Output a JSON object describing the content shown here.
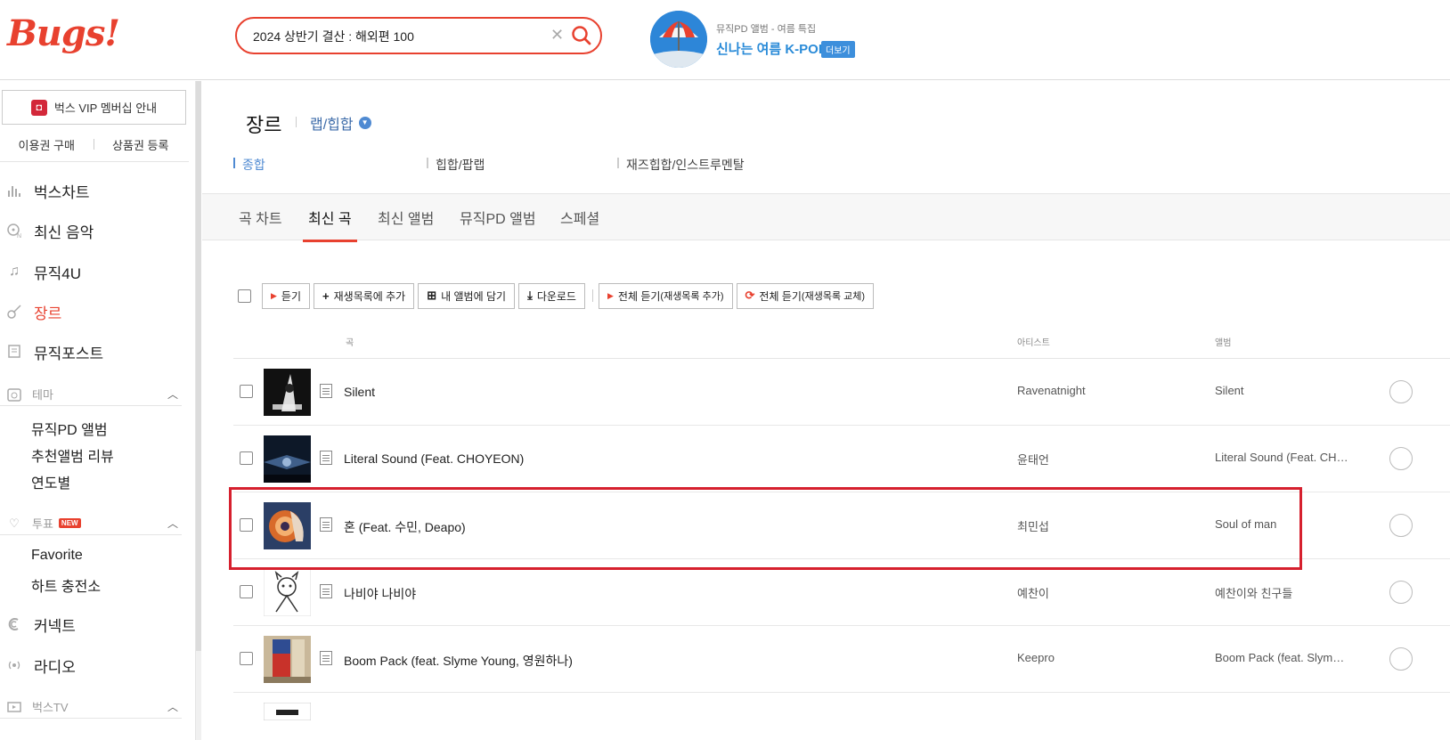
{
  "brand": {
    "logo_text": "Bugs!",
    "accent_color": "#e8412f"
  },
  "search": {
    "value": "2024 상반기 결산 : 해외편 100",
    "clear_icon": "close-icon",
    "search_icon": "search-icon"
  },
  "promo": {
    "subtitle": "뮤직PD 앨범 - 여름 특집",
    "title": "신나는 여름 K-POP",
    "more_label": "더보기"
  },
  "sidebar": {
    "vip_label": "벅스 VIP 멤버십 안내",
    "links": [
      "이용권 구매",
      "상품권 등록"
    ],
    "items": [
      {
        "label": "벅스차트",
        "icon": "chart-icon"
      },
      {
        "label": "최신 음악",
        "icon": "new-music-icon"
      },
      {
        "label": "뮤직4U",
        "icon": "music-note-icon"
      },
      {
        "label": "장르",
        "icon": "guitar-icon",
        "active": true
      },
      {
        "label": "뮤직포스트",
        "icon": "post-icon"
      }
    ],
    "theme": {
      "label": "테마",
      "items": [
        "뮤직PD 앨범",
        "추천앨범 리뷰",
        "연도별"
      ]
    },
    "vote": {
      "label": "투표",
      "badge": "NEW",
      "items": [
        "Favorite",
        "하트 충전소"
      ]
    },
    "bottom_items": [
      {
        "label": "커넥트",
        "icon": "connect-icon"
      },
      {
        "label": "라디오",
        "icon": "radio-icon"
      }
    ],
    "tv": {
      "label": "벅스TV"
    }
  },
  "main": {
    "title": "장르",
    "genre": "랩/힙합",
    "subgenres": [
      "종합",
      "힙합/팝랩",
      "재즈힙합/인스트루멘탈"
    ],
    "tabs": [
      "곡 차트",
      "최신 곡",
      "최신 앨범",
      "뮤직PD 앨범",
      "스페셜"
    ],
    "active_tab": "최신 곡",
    "toolbar": {
      "listen": "듣기",
      "add_playlist": "재생목록에 추가",
      "add_album": "내 앨범에 담기",
      "download": "다운로드",
      "play_all_add": "전체 듣기",
      "play_all_add_sub": "(재생목록 추가)",
      "play_all_replace": "전체 듣기",
      "play_all_replace_sub": "(재생목록 교체)"
    },
    "columns": {
      "song": "곡",
      "artist": "아티스트",
      "album": "앨범"
    },
    "tracks": [
      {
        "title": "Silent",
        "artist": "Ravenatnight",
        "album": "Silent"
      },
      {
        "title": "Literal Sound (Feat. CHOYEON)",
        "artist": "윤태언",
        "album": "Literal Sound (Feat. CH…"
      },
      {
        "title": "혼 (Feat. 수민, Deapo)",
        "artist": "최민섭",
        "album": "Soul of man"
      },
      {
        "title": "나비야 나비야",
        "artist": "예찬이",
        "album": "예찬이와 친구들"
      },
      {
        "title": "Boom Pack (feat. Slyme Young, 영원하나)",
        "artist": "Keepro",
        "album": "Boom Pack (feat. Slyme …"
      }
    ]
  },
  "highlight": {
    "row_index": 2,
    "color": "#d6202e"
  }
}
